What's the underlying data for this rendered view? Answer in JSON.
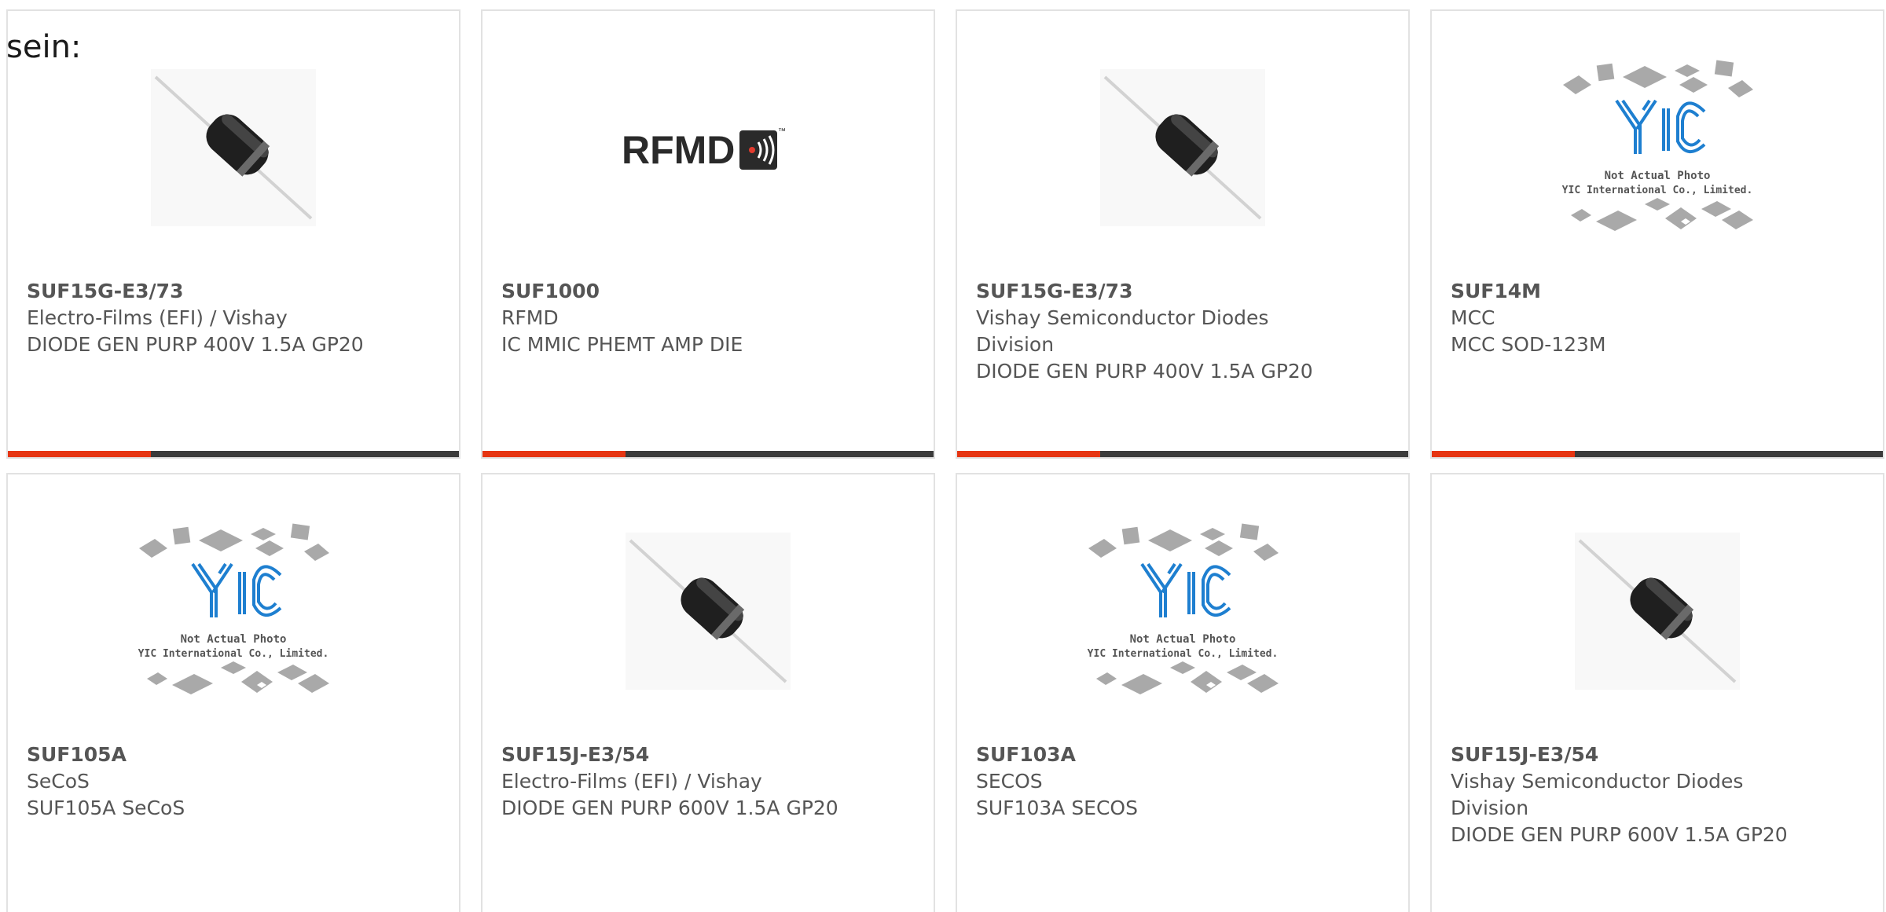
{
  "leadin": "sein:",
  "colors": {
    "accent": "#e63512",
    "bar": "#3b3b3b",
    "text": "#555555",
    "border": "#e2e2e2",
    "yic_logo": "#1e7fd0"
  },
  "products": [
    {
      "part": "SUF15G-E3/73",
      "manufacturer": "Electro-Films (EFI) / Vishay",
      "description": "DIODE GEN PURP 400V 1.5A GP20",
      "image": "axial-diode"
    },
    {
      "part": "SUF1000",
      "manufacturer": "RFMD",
      "description": "IC MMIC PHEMT AMP DIE",
      "image": "rfmd-logo",
      "logo_text": "RFMD",
      "logo_tm": "™"
    },
    {
      "part": "SUF15G-E3/73",
      "manufacturer": "Vishay Semiconductor Diodes Division",
      "description": "DIODE GEN PURP 400V 1.5A GP20",
      "image": "axial-diode"
    },
    {
      "part": "SUF14M",
      "manufacturer": "MCC",
      "description": "MCC SOD-123M",
      "image": "yic-placeholder",
      "placeholder_line1": "Not Actual Photo",
      "placeholder_line2": "YIC International Co., Limited."
    },
    {
      "part": "SUF105A",
      "manufacturer": "SeCoS",
      "description": "SUF105A SeCoS",
      "image": "yic-placeholder",
      "placeholder_line1": "Not Actual Photo",
      "placeholder_line2": "YIC International Co., Limited."
    },
    {
      "part": "SUF15J-E3/54",
      "manufacturer": "Electro-Films (EFI) / Vishay",
      "description": "DIODE GEN PURP 600V 1.5A GP20",
      "image": "axial-diode"
    },
    {
      "part": "SUF103A",
      "manufacturer": "SECOS",
      "description": "SUF103A SECOS",
      "image": "yic-placeholder",
      "placeholder_line1": "Not Actual Photo",
      "placeholder_line2": "YIC International Co., Limited."
    },
    {
      "part": "SUF15J-E3/54",
      "manufacturer": "Vishay Semiconductor Diodes Division",
      "description": "DIODE GEN PURP 600V 1.5A GP20",
      "image": "axial-diode"
    }
  ]
}
